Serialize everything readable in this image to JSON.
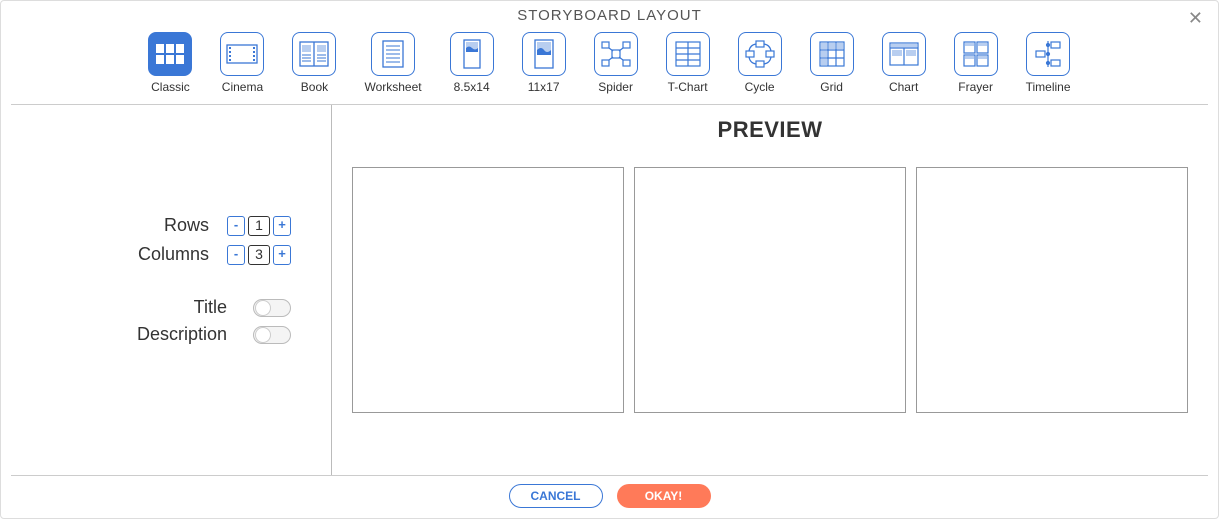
{
  "title": "STORYBOARD LAYOUT",
  "layouts": [
    {
      "label": "Classic",
      "selected": true
    },
    {
      "label": "Cinema",
      "selected": false
    },
    {
      "label": "Book",
      "selected": false
    },
    {
      "label": "Worksheet",
      "selected": false
    },
    {
      "label": "8.5x14",
      "selected": false
    },
    {
      "label": "11x17",
      "selected": false
    },
    {
      "label": "Spider",
      "selected": false
    },
    {
      "label": "T-Chart",
      "selected": false
    },
    {
      "label": "Cycle",
      "selected": false
    },
    {
      "label": "Grid",
      "selected": false
    },
    {
      "label": "Chart",
      "selected": false
    },
    {
      "label": "Frayer",
      "selected": false
    },
    {
      "label": "Timeline",
      "selected": false
    }
  ],
  "controls": {
    "rows_label": "Rows",
    "rows_value": "1",
    "columns_label": "Columns",
    "columns_value": "3",
    "title_label": "Title",
    "title_on": false,
    "description_label": "Description",
    "description_on": false,
    "minus": "-",
    "plus": "+"
  },
  "preview": {
    "heading": "PREVIEW",
    "rows": 1,
    "columns": 3
  },
  "footer": {
    "cancel": "CANCEL",
    "ok": "OKAY!"
  }
}
